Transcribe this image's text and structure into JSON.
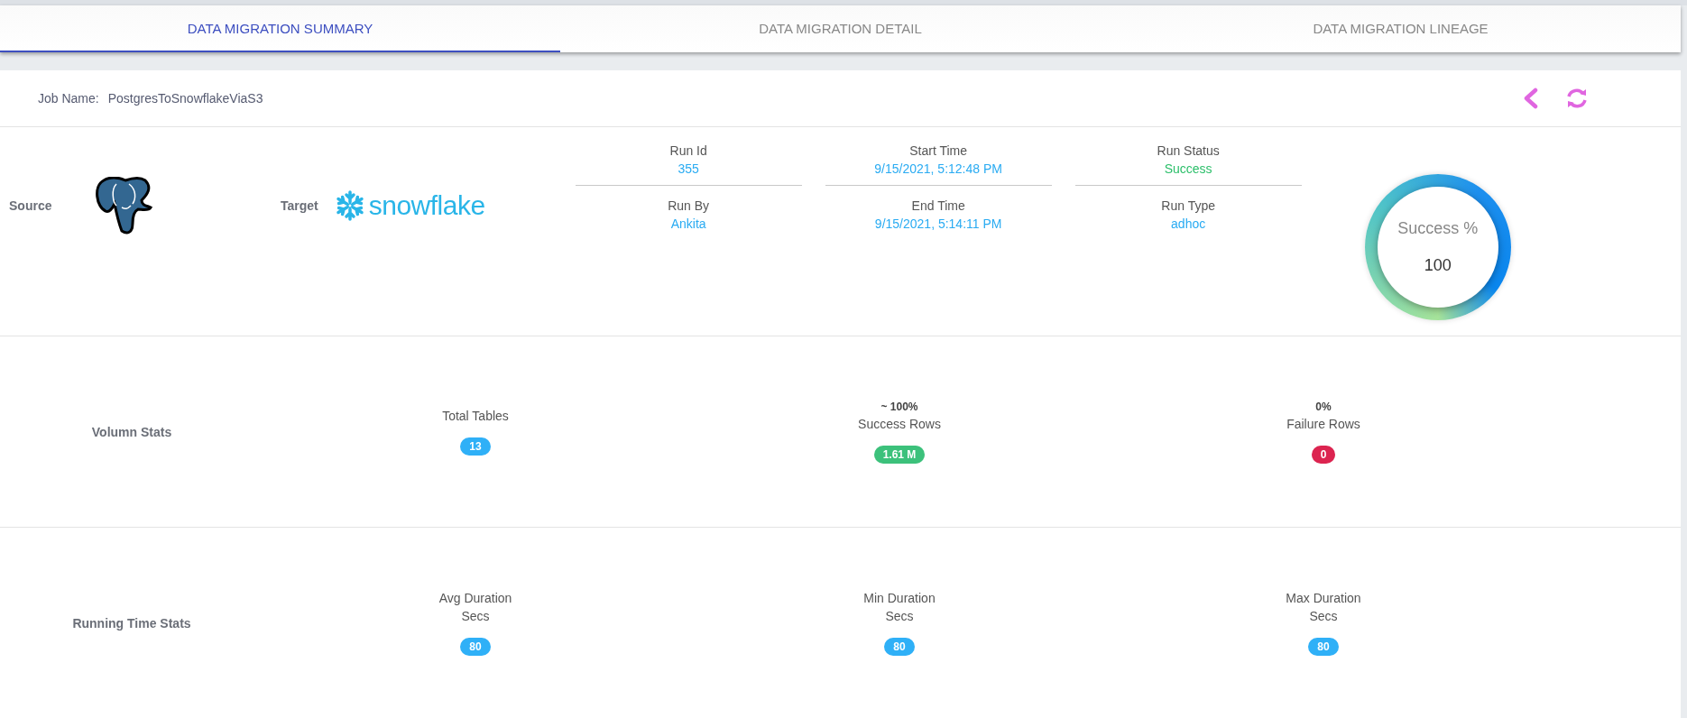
{
  "tabs": [
    {
      "label": "DATA MIGRATION SUMMARY",
      "selected": true
    },
    {
      "label": "DATA MIGRATION DETAIL",
      "selected": false
    },
    {
      "label": "DATA MIGRATION LINEAGE",
      "selected": false
    }
  ],
  "job": {
    "label": "Job Name:",
    "name": "PostgresToSnowflakeViaS3"
  },
  "source": {
    "label": "Source"
  },
  "target": {
    "label": "Target",
    "logo_text": "snowflake"
  },
  "run_info": [
    {
      "label": "Run Id",
      "value": "355",
      "color": "#29abf2"
    },
    {
      "label": "Start Time",
      "value": "9/15/2021, 5:12:48 PM",
      "color": "#29abf2"
    },
    {
      "label": "Run Status",
      "value": "Success",
      "color": "#2cbf6a"
    },
    {
      "label": "Run By",
      "value": "Ankita",
      "color": "#29abf2"
    },
    {
      "label": "End Time",
      "value": "9/15/2021, 5:14:11 PM",
      "color": "#29abf2"
    },
    {
      "label": "Run Type",
      "value": "adhoc",
      "color": "#29abf2"
    }
  ],
  "success": {
    "label": "Success %",
    "value": "100"
  },
  "volume_stats": {
    "label": "Volumn Stats",
    "items": [
      {
        "label": "Total Tables",
        "value": "13",
        "color": "#2fb0f7"
      },
      {
        "note": "~ 100%",
        "label": "Success Rows",
        "value": "1.61 M",
        "color": "#3cc17b"
      },
      {
        "note": "0%",
        "label": "Failure Rows",
        "value": "0",
        "color": "#dc2450"
      }
    ]
  },
  "running_time_stats": {
    "label": "Running Time Stats",
    "items": [
      {
        "label": "Avg Duration",
        "unit": "Secs",
        "value": "80",
        "color": "#2fb0f7"
      },
      {
        "label": "Min Duration",
        "unit": "Secs",
        "value": "80",
        "color": "#2fb0f7"
      },
      {
        "label": "Max Duration",
        "unit": "Secs",
        "value": "80",
        "color": "#2fb0f7"
      }
    ]
  }
}
